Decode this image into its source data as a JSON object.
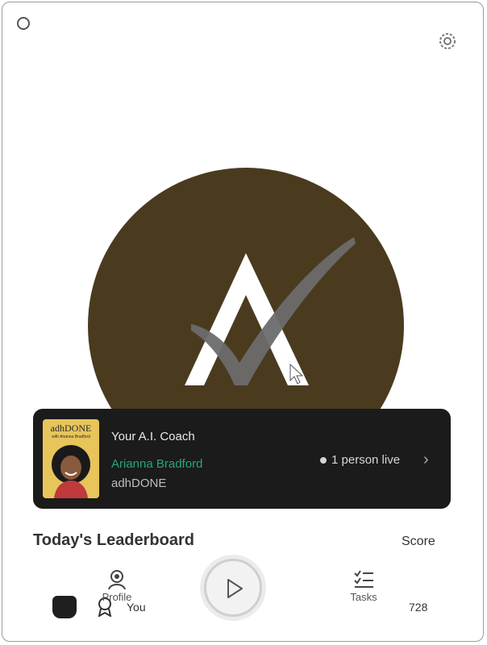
{
  "colors": {
    "logo_circle": "#4a3b1f",
    "card_bg": "#1b1b1b",
    "host_accent": "#22a87a",
    "cover_bg": "#e7c55a"
  },
  "icons": {
    "window": "circle-outline-icon",
    "settings": "gear-icon",
    "live": "live-dot-icon",
    "more": "chevron-right-icon",
    "profile": "profile-icon",
    "tasks": "tasks-list-icon",
    "play": "play-icon"
  },
  "now_playing": {
    "cover_title": "adhDONE",
    "cover_subtitle": "with Arianna Bradford",
    "title": "Your A.I. Coach",
    "host": "Arianna Bradford",
    "show": "adhDONE",
    "live_text": "1 person live"
  },
  "leaderboard": {
    "title": "Today's Leaderboard",
    "score_label": "Score",
    "rows": [
      {
        "name": "You",
        "score": "728"
      }
    ]
  },
  "nav": {
    "profile_label": "Profile",
    "tasks_label": "Tasks"
  }
}
